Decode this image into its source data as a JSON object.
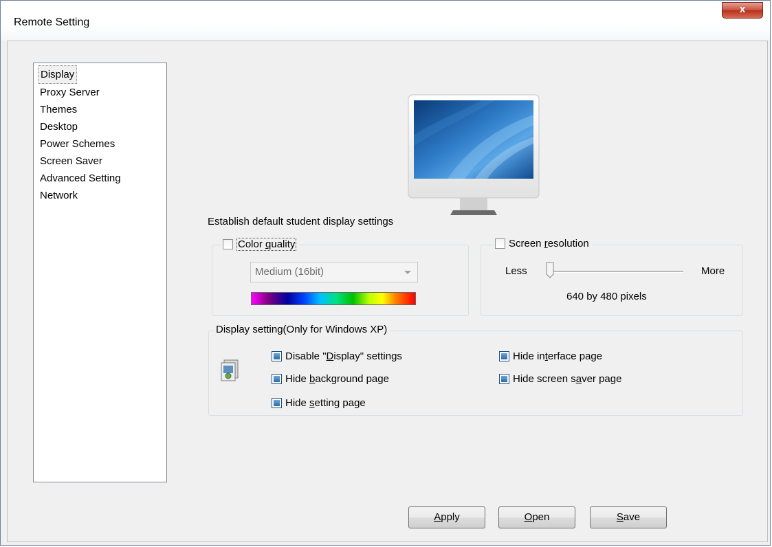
{
  "window": {
    "title": "Remote Setting",
    "close_label": "x"
  },
  "sidebar": {
    "items": [
      {
        "label": "Display",
        "selected": true
      },
      {
        "label": "Proxy Server"
      },
      {
        "label": "Themes"
      },
      {
        "label": "Desktop"
      },
      {
        "label": "Power Schemes"
      },
      {
        "label": "Screen Saver"
      },
      {
        "label": "Advanced Setting"
      },
      {
        "label": "Network"
      }
    ]
  },
  "main": {
    "description": "Establish default student display settings",
    "color_quality": {
      "legend": "Color quality",
      "legend_parts": [
        "Color ",
        "q",
        "uality"
      ],
      "checked": false,
      "dropdown_value": "Medium (16bit)"
    },
    "screen_resolution": {
      "legend": "Screen resolution",
      "legend_parts": [
        "Screen ",
        "r",
        "esolution"
      ],
      "checked": false,
      "less_label": "Less",
      "more_label": "More",
      "value_text": "640 by 480 pixels",
      "slider_level": 0
    },
    "display_setting": {
      "legend": "Display setting(Only for Windows XP)",
      "options": [
        {
          "label": "Disable \"Display\" settings",
          "parts": [
            "Disable \"",
            "D",
            "isplay\" settings"
          ],
          "checked": true
        },
        {
          "label": "Hide interface page",
          "parts": [
            "Hide in",
            "t",
            "erface page"
          ],
          "checked": true
        },
        {
          "label": "Hide background page",
          "parts": [
            "Hide ",
            "b",
            "ackground page"
          ],
          "checked": true
        },
        {
          "label": "Hide screen saver page",
          "parts": [
            "Hide screen s",
            "a",
            "ver page"
          ],
          "checked": true
        },
        {
          "label": "Hide setting page",
          "parts": [
            "Hide ",
            "s",
            "etting page"
          ],
          "checked": true
        }
      ]
    }
  },
  "buttons": {
    "apply": {
      "label": "Apply",
      "parts": [
        "",
        "A",
        "pply"
      ]
    },
    "open": {
      "label": "Open",
      "parts": [
        "",
        "O",
        "pen"
      ]
    },
    "save": {
      "label": "Save",
      "parts": [
        "",
        "S",
        "ave"
      ]
    }
  }
}
